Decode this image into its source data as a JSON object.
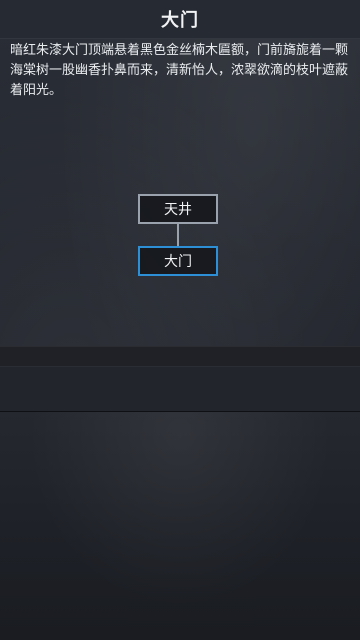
{
  "header": {
    "title": "大门"
  },
  "room": {
    "description": "暗红朱漆大门顶端悬着黑色金丝楠木匾额，门前旖旎着一颗海棠树一股幽香扑鼻而来，清新怡人，浓翠欲滴的枝叶遮蔽着阳光。"
  },
  "map": {
    "nodes": [
      {
        "label": "天井"
      },
      {
        "label": "大门",
        "current": true
      }
    ],
    "colors": {
      "node_border": "#9aa3ad",
      "current_border": "#2d8fd6"
    }
  }
}
